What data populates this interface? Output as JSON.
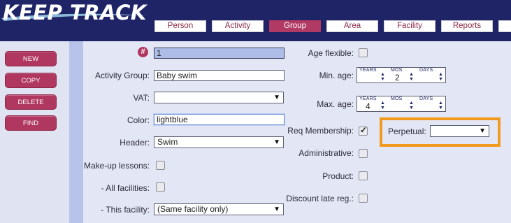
{
  "app": {
    "logo": "KEEP TRACK"
  },
  "nav": {
    "tabs": [
      {
        "label": "Person",
        "active": false
      },
      {
        "label": "Activity",
        "active": false
      },
      {
        "label": "Group",
        "active": true
      },
      {
        "label": "Area",
        "active": false
      },
      {
        "label": "Facility",
        "active": false
      },
      {
        "label": "Reports",
        "active": false
      },
      {
        "label": "",
        "active": false
      }
    ]
  },
  "actions": {
    "new": "NEW",
    "copy": "COPY",
    "delete": "DELETE",
    "find": "FIND"
  },
  "form": {
    "id_icon": "#",
    "id_value": "1",
    "activity_group_label": "Activity Group:",
    "activity_group_value": "Baby swim",
    "vat_label": "VAT:",
    "vat_value": "",
    "color_label": "Color:",
    "color_value": "lightblue",
    "header_label": "Header:",
    "header_value": "Swim",
    "makeup_label": "Make-up lessons:",
    "all_facilities_label": "- All facilities:",
    "this_facility_label": "- This facility:",
    "this_facility_value": "(Same facility only)",
    "age_flexible_label": "Age flexible:",
    "min_age_label": "Min. age:",
    "max_age_label": "Max. age:",
    "age_caps": {
      "years": "YEARS",
      "mos": "MOS",
      "days": "DAYS"
    },
    "min_age": {
      "years": "",
      "mos": "2",
      "days": ""
    },
    "max_age": {
      "years": "4",
      "mos": "",
      "days": ""
    },
    "req_membership_label": "Req Membership:",
    "administrative_label": "Administrative:",
    "product_label": "Product:",
    "discount_label": "Discount late reg.:",
    "perpetual_label": "Perpetual:",
    "perpetual_value": ""
  },
  "checkboxes": {
    "makeup": false,
    "all_facilities": false,
    "age_flexible": false,
    "req_membership": true,
    "administrative": false,
    "product": false,
    "discount": false
  },
  "colors": {
    "navy": "#1f2466",
    "brand": "#b0375f",
    "highlight": "#f29a1e"
  },
  "icons": {
    "dropdown": "chevron-down-icon",
    "check": "check-icon",
    "spin_up": "arrow-up-icon",
    "spin_down": "arrow-down-icon"
  }
}
